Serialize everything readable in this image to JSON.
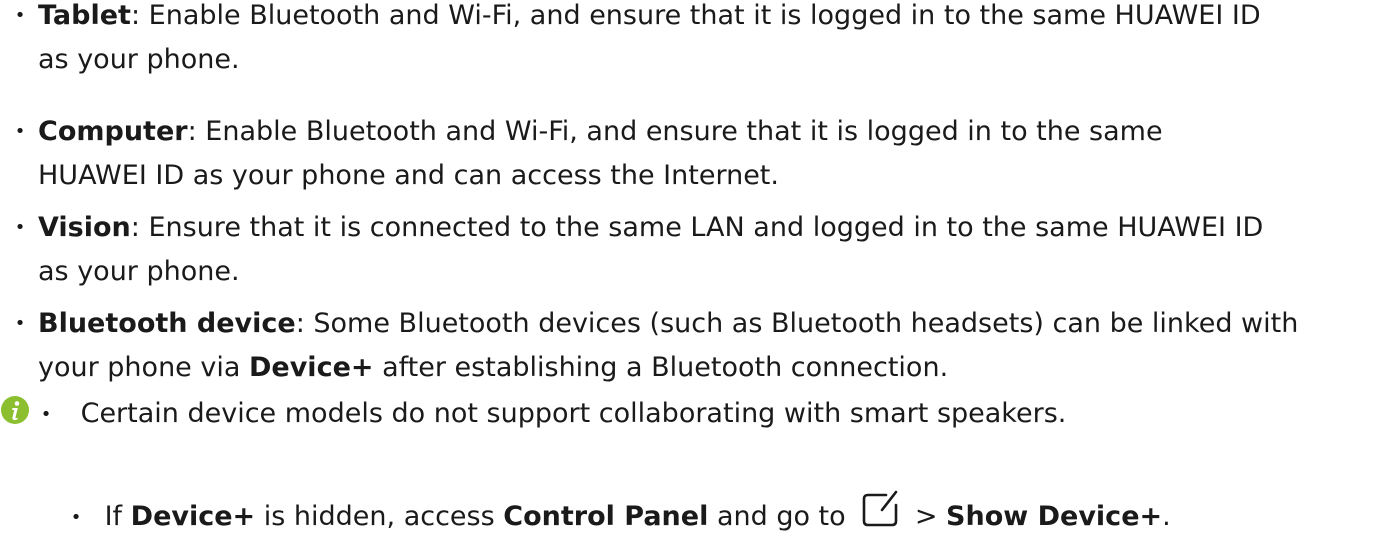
{
  "items": [
    {
      "term": "Tablet",
      "line1": ": Enable Bluetooth and Wi-Fi, and ensure that it is logged in to the same HUAWEI ID",
      "line2": "as your phone."
    },
    {
      "term": "Computer",
      "line1": ": Enable Bluetooth and Wi-Fi, and ensure that it is logged in to the same",
      "line2": "HUAWEI ID as your phone and can access the Internet."
    },
    {
      "term": "Vision",
      "line1": ": Ensure that it is connected to the same LAN and logged in to the same HUAWEI ID",
      "line2": "as your phone."
    },
    {
      "term": "Bluetooth device",
      "line1": ": Some Bluetooth devices (such as Bluetooth headsets) can be linked with",
      "line2_pre": "your phone via ",
      "line2_bold": "Device+",
      "line2_post": " after establishing a Bluetooth connection."
    }
  ],
  "note": {
    "icon": "info-icon",
    "line1": "Certain device models do not support collaborating with smart speakers.",
    "line2_pre": "If ",
    "line2_bold1": "Device+",
    "line2_mid": " is hidden, access ",
    "line2_bold2": "Control Panel",
    "line2_mid2": " and go to ",
    "line2_icon": "edit-icon",
    "line2_sep": " > ",
    "line2_bold3": "Show Device+",
    "line2_end": "."
  },
  "colors": {
    "text": "#1a1a1a",
    "info_icon": "#8bbf2f"
  }
}
